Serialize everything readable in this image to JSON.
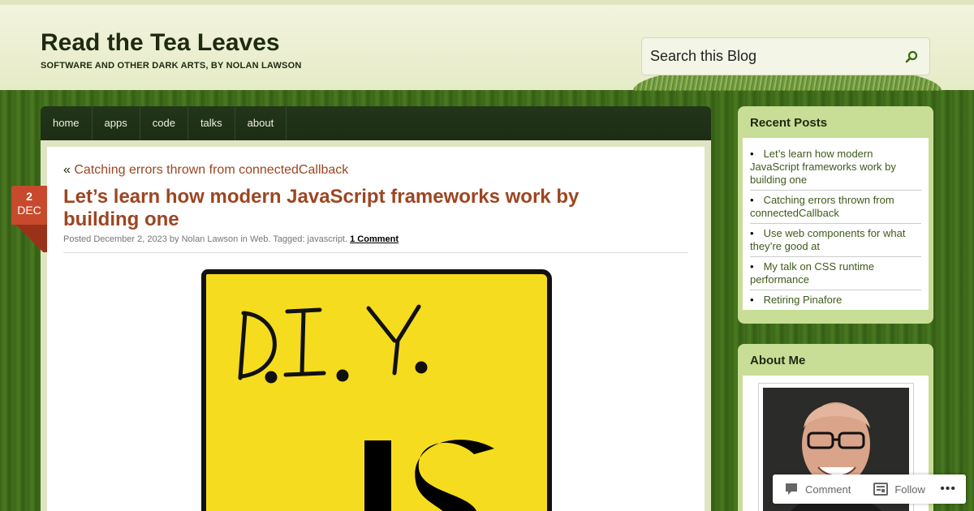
{
  "site": {
    "title": "Read the Tea Leaves",
    "description": "SOFTWARE AND OTHER DARK ARTS, BY NOLAN LAWSON"
  },
  "search": {
    "placeholder": "Search this Blog",
    "icon": "search-icon"
  },
  "nav": {
    "items": [
      {
        "label": "home"
      },
      {
        "label": "apps"
      },
      {
        "label": "code"
      },
      {
        "label": "talks"
      },
      {
        "label": "about"
      }
    ]
  },
  "post": {
    "date_day": "2",
    "date_month": "DEC",
    "prev_prefix": "«",
    "prev_link": "Catching errors thrown from connectedCallback",
    "title": "Let’s learn how modern JavaScript frameworks work by building one",
    "meta": {
      "posted": "Posted",
      "date": "December 2, 2023",
      "by": "by",
      "author": "Nolan Lawson",
      "in": "in",
      "category": "Web",
      "tagged_label": "Tagged:",
      "tag": "javascript",
      "comments": "1 Comment"
    }
  },
  "sidebar": {
    "recent_title": "Recent Posts",
    "recent_posts": [
      "Let’s learn how modern JavaScript frameworks work by building one",
      "Catching errors thrown from connectedCallback",
      "Use web components for what they’re good at",
      "My talk on CSS runtime performance",
      "Retiring Pinafore"
    ],
    "about_title": "About Me"
  },
  "actionbar": {
    "comment_label": "Comment",
    "follow_label": "Follow",
    "more_icon": "ellipsis-icon"
  },
  "colors": {
    "accent": "#9c4622",
    "widget": "#c8dd96",
    "date_badge": "#c8492c",
    "logo_yellow": "#f5dc1e"
  }
}
